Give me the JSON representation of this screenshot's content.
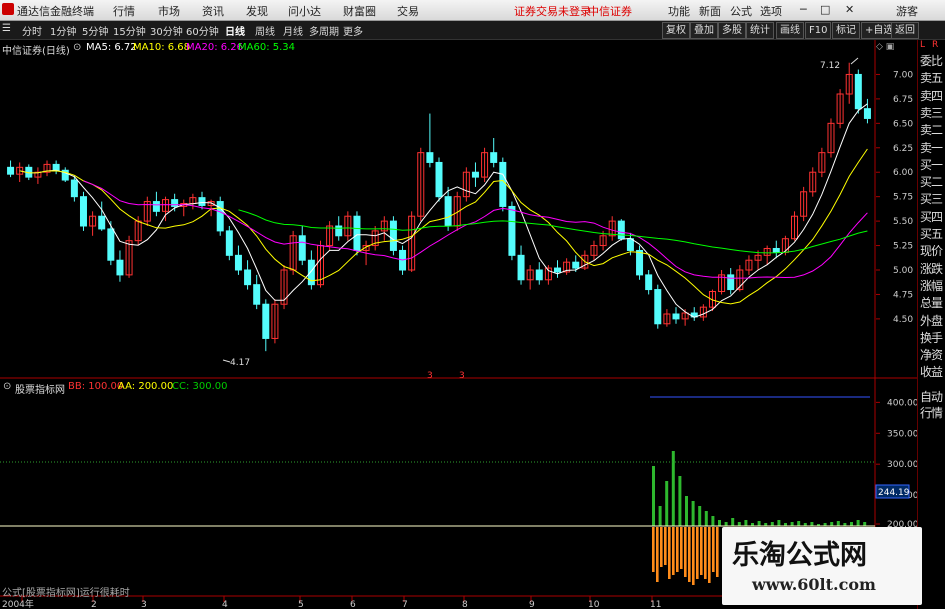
{
  "menubar": {
    "app_title": "通达信金融终端",
    "items": [
      "行情",
      "市场",
      "资讯",
      "发现",
      "问小达",
      "财富圈",
      "交易"
    ],
    "notice": "证券交易未登录",
    "broker": "中信证券",
    "right_items": [
      "功能",
      "新面",
      "公式",
      "选项"
    ],
    "user": "游客"
  },
  "toolbar": {
    "periods": [
      "分时",
      "1分钟",
      "5分钟",
      "15分钟",
      "30分钟",
      "60分钟",
      "日线",
      "周线",
      "月线",
      "多周期",
      "更多"
    ],
    "active_period": "日线",
    "right_buttons": [
      "复权",
      "叠加",
      "多股",
      "统计",
      "画线",
      "F10",
      "标记",
      "+自选",
      "返回"
    ]
  },
  "main_info": {
    "title": "中信证券(日线)",
    "ma5": "MA5: 6.72",
    "ma10": "MA10: 6.68",
    "ma20": "MA20: 6.26",
    "ma60": "MA60: 5.34"
  },
  "sub_info": {
    "title": "股票指标网",
    "bb": "BB: 100.00",
    "aa": "AA: 200.00",
    "cc": "CC: 300.00"
  },
  "price_annotations": {
    "high": "7.12",
    "low": "4.17"
  },
  "current_value": "244.19",
  "bottom_text": "公式[股票指标网]运行很耗时",
  "sidepanel": {
    "top_labels": [
      "L",
      "R"
    ],
    "items": [
      "委比",
      "卖五",
      "卖四",
      "卖三",
      "卖二",
      "卖一",
      "买一",
      "买二",
      "买三",
      "买四",
      "买五",
      "现价",
      "涨跌",
      "涨幅",
      "总量",
      "外盘",
      "换手",
      "净资",
      "收益"
    ],
    "sub_items": [
      "自动",
      "行情"
    ]
  },
  "watermark": {
    "title": "乐淘公式网",
    "url": "www.60lt.com"
  },
  "colors": {
    "up": "#ff3232",
    "down": "#54fcfc",
    "ma5": "#ffffff",
    "ma10": "#ffff00",
    "ma20": "#ff00ff",
    "ma60": "#00ff00"
  },
  "chart_data": [
    {
      "type": "line",
      "title": "中信证券(日线)",
      "x_ticks": [
        "2004年",
        "2",
        "3",
        "4",
        "5",
        "6",
        "7",
        "8",
        "9",
        "10",
        "11"
      ],
      "y_ticks": [
        4.5,
        4.75,
        5.0,
        5.25,
        5.5,
        5.75,
        6.0,
        6.25,
        6.5,
        6.75,
        7.0
      ],
      "ylim": [
        4.1,
        7.25
      ],
      "candles": [
        [
          6.05,
          6.12,
          5.95,
          5.98
        ],
        [
          5.98,
          6.1,
          5.9,
          6.05
        ],
        [
          6.05,
          6.08,
          5.92,
          5.95
        ],
        [
          5.95,
          6.05,
          5.88,
          6.0
        ],
        [
          6.0,
          6.12,
          5.96,
          6.08
        ],
        [
          6.08,
          6.12,
          5.98,
          6.02
        ],
        [
          6.02,
          6.05,
          5.9,
          5.92
        ],
        [
          5.92,
          5.96,
          5.7,
          5.75
        ],
        [
          5.75,
          5.8,
          5.4,
          5.45
        ],
        [
          5.45,
          5.6,
          5.35,
          5.55
        ],
        [
          5.55,
          5.7,
          5.4,
          5.42
        ],
        [
          5.42,
          5.5,
          5.05,
          5.1
        ],
        [
          5.1,
          5.2,
          4.88,
          4.95
        ],
        [
          4.95,
          5.35,
          4.92,
          5.3
        ],
        [
          5.3,
          5.55,
          5.25,
          5.5
        ],
        [
          5.5,
          5.75,
          5.45,
          5.7
        ],
        [
          5.7,
          5.8,
          5.55,
          5.6
        ],
        [
          5.6,
          5.75,
          5.5,
          5.72
        ],
        [
          5.72,
          5.78,
          5.6,
          5.65
        ],
        [
          5.65,
          5.72,
          5.55,
          5.68
        ],
        [
          5.68,
          5.78,
          5.62,
          5.74
        ],
        [
          5.74,
          5.8,
          5.62,
          5.66
        ],
        [
          5.66,
          5.72,
          5.55,
          5.7
        ],
        [
          5.7,
          5.75,
          5.35,
          5.4
        ],
        [
          5.4,
          5.45,
          5.1,
          5.15
        ],
        [
          5.15,
          5.25,
          4.95,
          5.0
        ],
        [
          5.0,
          5.1,
          4.8,
          4.85
        ],
        [
          4.85,
          4.95,
          4.6,
          4.65
        ],
        [
          4.65,
          4.7,
          4.17,
          4.3
        ],
        [
          4.3,
          4.7,
          4.25,
          4.65
        ],
        [
          4.65,
          5.05,
          4.6,
          5.0
        ],
        [
          5.0,
          5.4,
          4.95,
          5.35
        ],
        [
          5.35,
          5.45,
          5.05,
          5.1
        ],
        [
          5.1,
          5.2,
          4.8,
          4.85
        ],
        [
          4.85,
          5.3,
          4.82,
          5.25
        ],
        [
          5.25,
          5.5,
          5.2,
          5.45
        ],
        [
          5.45,
          5.55,
          5.3,
          5.35
        ],
        [
          5.35,
          5.6,
          5.3,
          5.55
        ],
        [
          5.55,
          5.6,
          5.15,
          5.2
        ],
        [
          5.2,
          5.3,
          5.05,
          5.25
        ],
        [
          5.25,
          5.45,
          5.2,
          5.4
        ],
        [
          5.4,
          5.55,
          5.3,
          5.5
        ],
        [
          5.5,
          5.55,
          5.15,
          5.2
        ],
        [
          5.2,
          5.25,
          4.95,
          5.0
        ],
        [
          5.0,
          5.6,
          4.98,
          5.55
        ],
        [
          5.55,
          6.25,
          5.5,
          6.2
        ],
        [
          6.2,
          6.6,
          6.05,
          6.1
        ],
        [
          6.1,
          6.15,
          5.7,
          5.75
        ],
        [
          5.75,
          5.85,
          5.4,
          5.45
        ],
        [
          5.45,
          5.8,
          5.4,
          5.75
        ],
        [
          5.75,
          6.05,
          5.7,
          6.0
        ],
        [
          6.0,
          6.1,
          5.85,
          5.95
        ],
        [
          5.95,
          6.25,
          5.9,
          6.2
        ],
        [
          6.2,
          6.35,
          6.05,
          6.1
        ],
        [
          6.1,
          6.15,
          5.6,
          5.65
        ],
        [
          5.65,
          5.7,
          5.1,
          5.15
        ],
        [
          5.15,
          5.25,
          4.85,
          4.9
        ],
        [
          4.9,
          5.05,
          4.8,
          5.0
        ],
        [
          5.0,
          5.08,
          4.85,
          4.9
        ],
        [
          4.9,
          5.05,
          4.85,
          5.02
        ],
        [
          5.02,
          5.1,
          4.92,
          4.98
        ],
        [
          4.98,
          5.12,
          4.95,
          5.08
        ],
        [
          5.08,
          5.15,
          4.98,
          5.02
        ],
        [
          5.02,
          5.2,
          5.0,
          5.15
        ],
        [
          5.15,
          5.3,
          5.1,
          5.25
        ],
        [
          5.25,
          5.4,
          5.2,
          5.35
        ],
        [
          5.35,
          5.55,
          5.3,
          5.5
        ],
        [
          5.5,
          5.52,
          5.3,
          5.32
        ],
        [
          5.32,
          5.38,
          5.15,
          5.2
        ],
        [
          5.2,
          5.25,
          4.9,
          4.95
        ],
        [
          4.95,
          5.0,
          4.75,
          4.8
        ],
        [
          4.8,
          4.85,
          4.4,
          4.45
        ],
        [
          4.45,
          4.6,
          4.42,
          4.55
        ],
        [
          4.55,
          4.62,
          4.45,
          4.5
        ],
        [
          4.5,
          4.6,
          4.43,
          4.56
        ],
        [
          4.56,
          4.62,
          4.48,
          4.52
        ],
        [
          4.52,
          4.65,
          4.48,
          4.62
        ],
        [
          4.62,
          4.8,
          4.58,
          4.78
        ],
        [
          4.78,
          5.0,
          4.75,
          4.95
        ],
        [
          4.95,
          5.02,
          4.75,
          4.8
        ],
        [
          4.8,
          5.05,
          4.78,
          5.0
        ],
        [
          5.0,
          5.15,
          4.95,
          5.1
        ],
        [
          5.1,
          5.2,
          5.0,
          5.15
        ],
        [
          5.15,
          5.25,
          5.05,
          5.22
        ],
        [
          5.22,
          5.3,
          5.12,
          5.18
        ],
        [
          5.18,
          5.35,
          5.15,
          5.32
        ],
        [
          5.32,
          5.6,
          5.3,
          5.55
        ],
        [
          5.55,
          5.85,
          5.5,
          5.8
        ],
        [
          5.8,
          6.05,
          5.75,
          6.0
        ],
        [
          6.0,
          6.25,
          5.95,
          6.2
        ],
        [
          6.2,
          6.55,
          6.15,
          6.5
        ],
        [
          6.5,
          6.85,
          6.45,
          6.8
        ],
        [
          6.8,
          7.12,
          6.7,
          7.0
        ],
        [
          7.0,
          7.05,
          6.6,
          6.65
        ],
        [
          6.65,
          6.75,
          6.5,
          6.55
        ]
      ]
    },
    {
      "type": "bar",
      "title": "股票指标网",
      "y_ticks": [
        200,
        250,
        300,
        350,
        400
      ],
      "ylim": [
        150,
        420
      ],
      "series": [
        {
          "name": "BB",
          "values": [
            100
          ]
        },
        {
          "name": "AA",
          "values": [
            200
          ]
        },
        {
          "name": "CC",
          "values": [
            300
          ]
        }
      ],
      "last_value": 244.19
    }
  ]
}
